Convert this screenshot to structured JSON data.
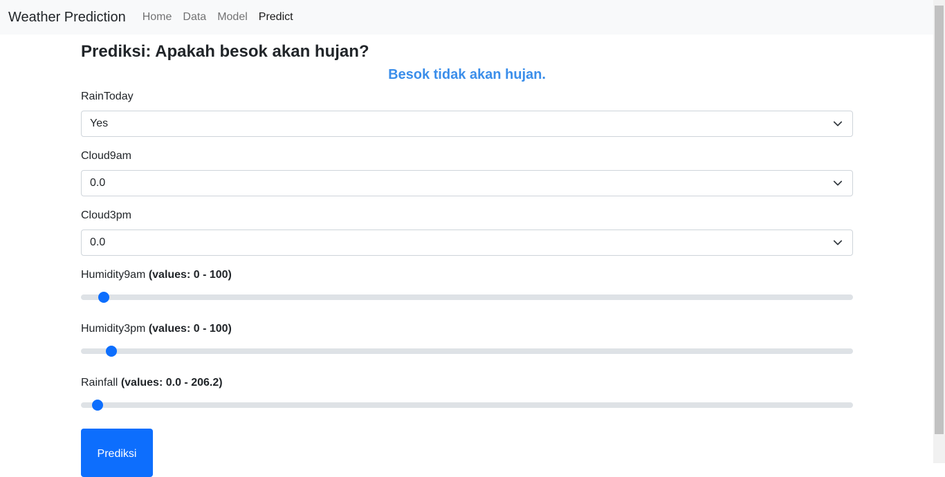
{
  "navbar": {
    "brand": "Weather Prediction",
    "links": [
      "Home",
      "Data",
      "Model",
      "Predict"
    ],
    "active": "Predict"
  },
  "page": {
    "title": "Prediksi: Apakah besok akan hujan?",
    "result": "Besok tidak akan hujan.",
    "result_color": "#3b8eea",
    "accent_color": "#0d6efd"
  },
  "form": {
    "rain_today": {
      "label": "RainToday",
      "value": "Yes"
    },
    "cloud9am": {
      "label": "Cloud9am",
      "value": "0.0"
    },
    "cloud3pm": {
      "label": "Cloud3pm",
      "value": "0.0"
    },
    "humidity9am": {
      "label": "Humidity9am",
      "hint": "(values: 0 - 100)",
      "value": 2
    },
    "humidity3pm": {
      "label": "Humidity3pm",
      "hint": "(values: 0 - 100)",
      "value": 3
    },
    "rainfall": {
      "label": "Rainfall",
      "hint": "(values: 0.0 - 206.2)",
      "value": 2.5
    },
    "submit_label": "Prediksi"
  },
  "icons": {
    "select_arrow": "chevron-down-icon"
  }
}
